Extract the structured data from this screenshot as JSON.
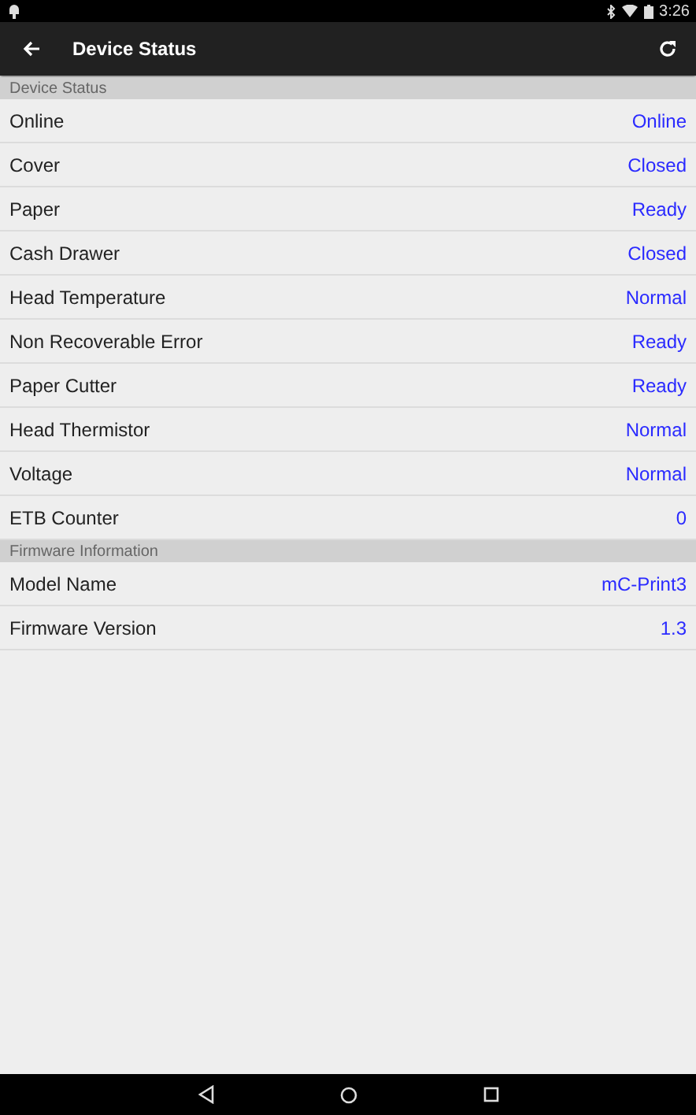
{
  "status_bar": {
    "time": "3:26"
  },
  "toolbar": {
    "title": "Device Status"
  },
  "sections": [
    {
      "header": "Device Status",
      "rows": [
        {
          "label": "Online",
          "value": "Online"
        },
        {
          "label": "Cover",
          "value": "Closed"
        },
        {
          "label": "Paper",
          "value": "Ready"
        },
        {
          "label": "Cash Drawer",
          "value": "Closed"
        },
        {
          "label": "Head Temperature",
          "value": "Normal"
        },
        {
          "label": "Non Recoverable Error",
          "value": "Ready"
        },
        {
          "label": "Paper Cutter",
          "value": "Ready"
        },
        {
          "label": "Head Thermistor",
          "value": "Normal"
        },
        {
          "label": "Voltage",
          "value": "Normal"
        },
        {
          "label": "ETB Counter",
          "value": "0"
        }
      ]
    },
    {
      "header": "Firmware Information",
      "rows": [
        {
          "label": "Model Name",
          "value": "mC-Print3"
        },
        {
          "label": "Firmware Version",
          "value": "1.3"
        }
      ]
    }
  ]
}
